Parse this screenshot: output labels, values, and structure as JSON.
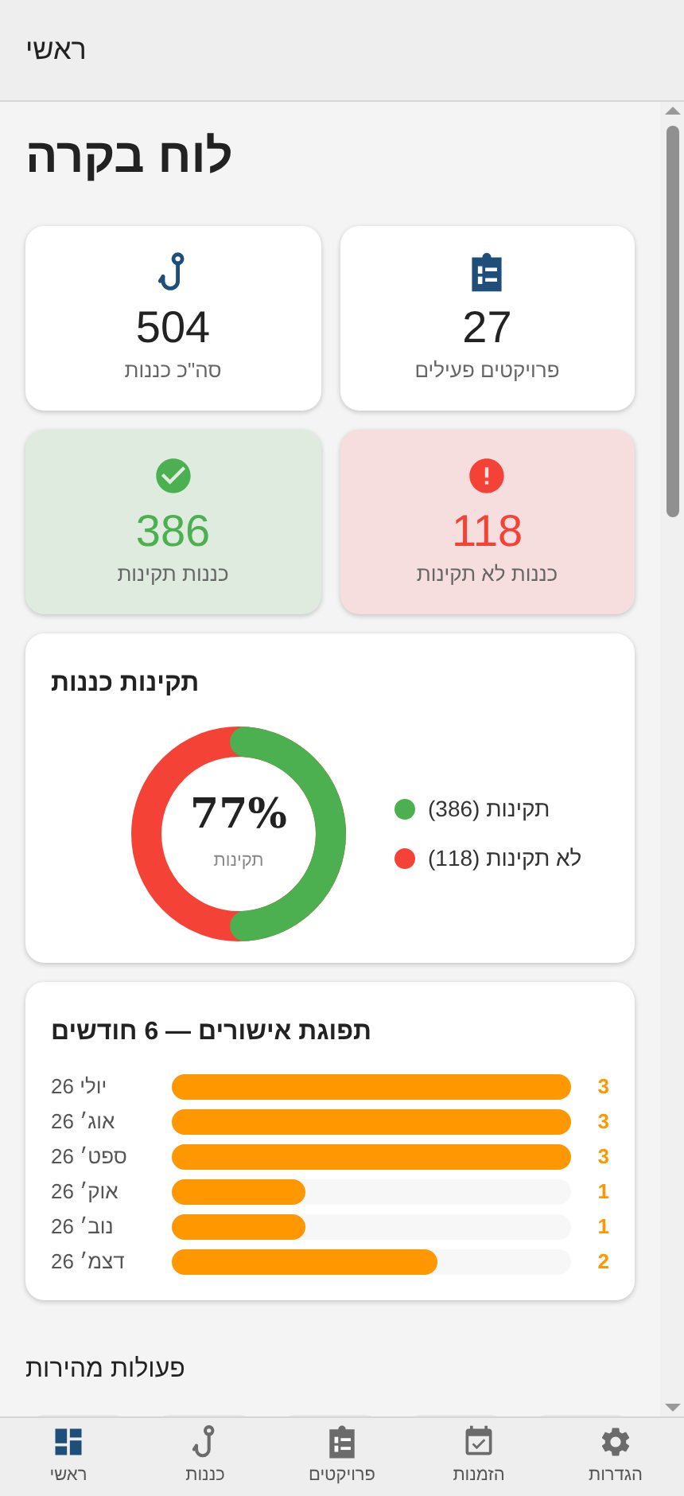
{
  "header": {
    "title": "ראשי"
  },
  "page_title": "לוח בקרה",
  "stats": [
    {
      "kind": "projects",
      "value": "27",
      "label": "פרויקטים פעילים"
    },
    {
      "kind": "hook",
      "value": "504",
      "label": "סה\"כ כננות"
    },
    {
      "kind": "alert",
      "value": "118",
      "label": "כננות לא תקינות"
    },
    {
      "kind": "check",
      "value": "386",
      "label": "כננות תקינות"
    }
  ],
  "compliance": {
    "title": "תקינות כננות",
    "center_value": "77%",
    "center_label": "תקינות",
    "legend": [
      {
        "label": "תקינות (386)",
        "color": "#4caf50"
      },
      {
        "label": "לא תקינות (118)",
        "color": "#f44336"
      }
    ]
  },
  "approvals": {
    "title": "תפוגת אישורים — 6 חודשים",
    "chart_data": {
      "type": "bar",
      "orientation": "horizontal",
      "data_labels": true,
      "categories": [
        "יולי 26",
        "אוג׳ 26",
        "ספט׳ 26",
        "אוק׳ 26",
        "נוב׳ 26",
        "דצמ׳ 26"
      ],
      "values": [
        3,
        3,
        3,
        1,
        1,
        2
      ]
    }
  },
  "quick_actions": {
    "title": "פעולות מהירות"
  },
  "nav": [
    {
      "kind": "settings",
      "label": "הגדרות",
      "selected": false
    },
    {
      "kind": "calendar",
      "label": "הזמנות",
      "selected": false
    },
    {
      "kind": "projects",
      "label": "פרויקטים",
      "selected": false
    },
    {
      "kind": "hook",
      "label": "כננות",
      "selected": false
    },
    {
      "kind": "dashboard",
      "label": "ראשי",
      "selected": true
    }
  ]
}
